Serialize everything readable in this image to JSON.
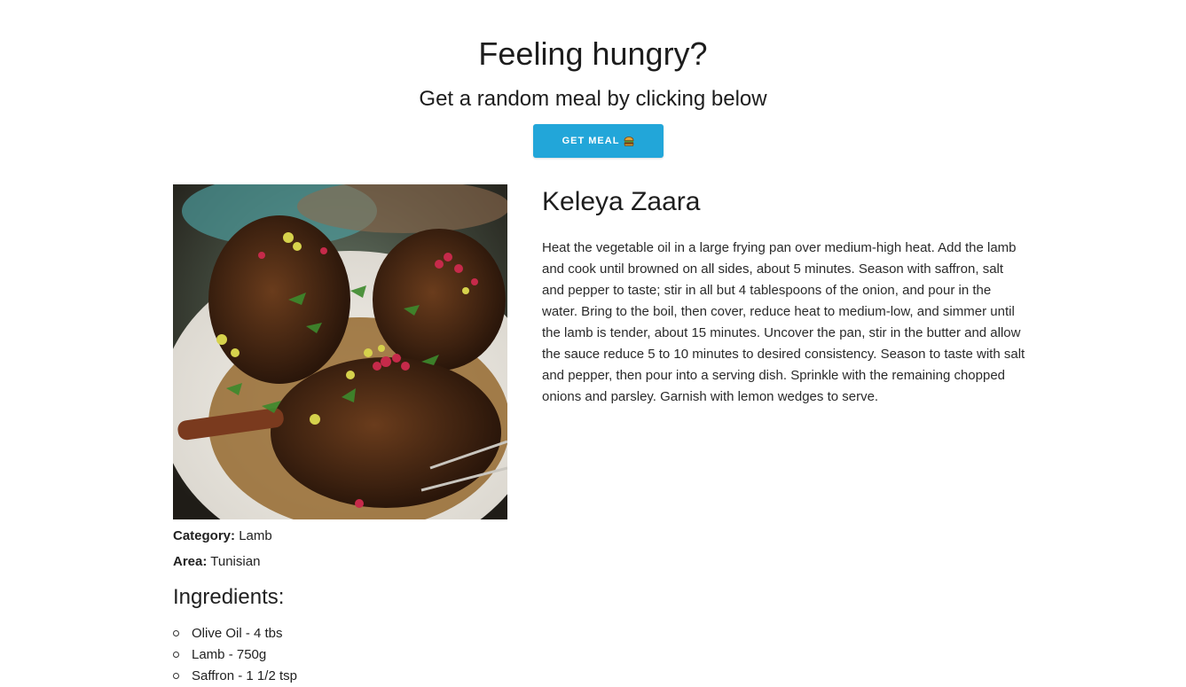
{
  "header": {
    "title": "Feeling hungry?",
    "subtitle": "Get a random meal by clicking below",
    "button_label": "GET MEAL",
    "button_icon": "burger-icon",
    "button_color": "#22a6d9"
  },
  "meal": {
    "name": "Keleya Zaara",
    "instructions": "Heat the vegetable oil in a large frying pan over medium-high heat. Add the lamb and cook until browned on all sides, about 5 minutes. Season with saffron, salt and pepper to taste; stir in all but 4 tablespoons of the onion, and pour in the water. Bring to the boil, then cover, reduce heat to medium-low, and simmer until the lamb is tender, about 15 minutes. Uncover the pan, stir in the butter and allow the sauce reduce 5 to 10 minutes to desired consistency. Season to taste with salt and pepper, then pour into a serving dish. Sprinkle with the remaining chopped onions and parsley. Garnish with lemon wedges to serve.",
    "category_label": "Category:",
    "category": "Lamb",
    "area_label": "Area:",
    "area": "Tunisian",
    "ingredients_title": "Ingredients:",
    "ingredients": [
      "Olive Oil - 4 tbs",
      "Lamb - 750g",
      "Saffron - 1 1/2 tsp"
    ]
  }
}
